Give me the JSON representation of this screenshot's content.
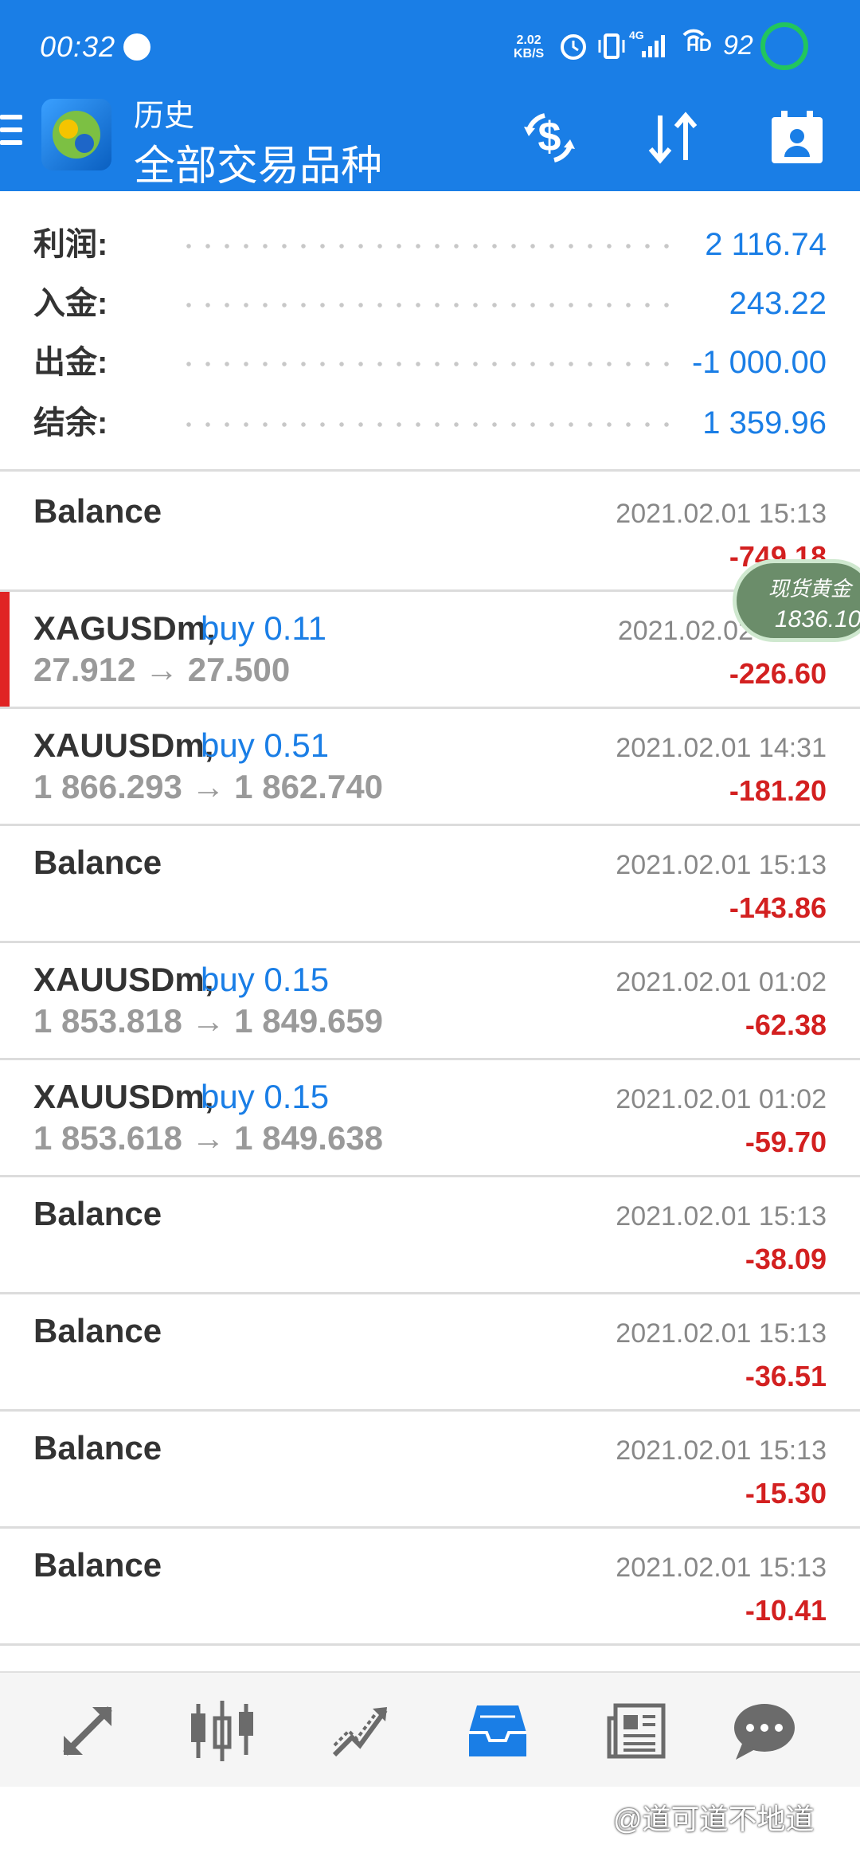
{
  "status_bar": {
    "time": "00:32",
    "speed_value": "2.02",
    "speed_unit": "KB/S",
    "network": "4G",
    "hd": "HD",
    "battery": "92"
  },
  "toolbar": {
    "title": "历史",
    "subtitle": "全部交易品种"
  },
  "summary": [
    {
      "label": "利润:",
      "value": "2 116.74"
    },
    {
      "label": "入金:",
      "value": "243.22"
    },
    {
      "label": "出金:",
      "value": "-1 000.00"
    },
    {
      "label": "结余:",
      "value": "1 359.96"
    }
  ],
  "deals": [
    {
      "symbol": "Balance",
      "type": "",
      "prices": "",
      "time": "2021.02.01 15:13",
      "profit": "-749.18"
    },
    {
      "symbol": "XAGUSDm,",
      "type": "buy 0.11",
      "prices": "27.912 → 27.500",
      "time": "2021.02.02 11:57",
      "profit": "-226.60"
    },
    {
      "symbol": "XAUUSDm,",
      "type": "buy 0.51",
      "prices": "1 866.293 → 1 862.740",
      "time": "2021.02.01 14:31",
      "profit": "-181.20"
    },
    {
      "symbol": "Balance",
      "type": "",
      "prices": "",
      "time": "2021.02.01 15:13",
      "profit": "-143.86"
    },
    {
      "symbol": "XAUUSDm,",
      "type": "buy 0.15",
      "prices": "1 853.818 → 1 849.659",
      "time": "2021.02.01 01:02",
      "profit": "-62.38"
    },
    {
      "symbol": "XAUUSDm,",
      "type": "buy 0.15",
      "prices": "1 853.618 → 1 849.638",
      "time": "2021.02.01 01:02",
      "profit": "-59.70"
    },
    {
      "symbol": "Balance",
      "type": "",
      "prices": "",
      "time": "2021.02.01 15:13",
      "profit": "-38.09"
    },
    {
      "symbol": "Balance",
      "type": "",
      "prices": "",
      "time": "2021.02.01 15:13",
      "profit": "-36.51"
    },
    {
      "symbol": "Balance",
      "type": "",
      "prices": "",
      "time": "2021.02.01 15:13",
      "profit": "-15.30"
    },
    {
      "symbol": "Balance",
      "type": "",
      "prices": "",
      "time": "2021.02.01 15:13",
      "profit": "-10.41"
    }
  ],
  "floating_widget": {
    "name": "现货黄金",
    "price": "1836.10"
  },
  "bottom_nav": [
    {
      "icon": "quotes-icon"
    },
    {
      "icon": "chart-icon"
    },
    {
      "icon": "trade-icon"
    },
    {
      "icon": "history-icon",
      "active": true
    },
    {
      "icon": "news-icon"
    },
    {
      "icon": "chat-icon"
    }
  ],
  "watermark": "@道可道不地道",
  "colors": {
    "header_bg": "#1a7ee6",
    "accent_blue": "#1a7ee6",
    "loss_red": "#d32020",
    "selected_marker": "#e02424"
  }
}
